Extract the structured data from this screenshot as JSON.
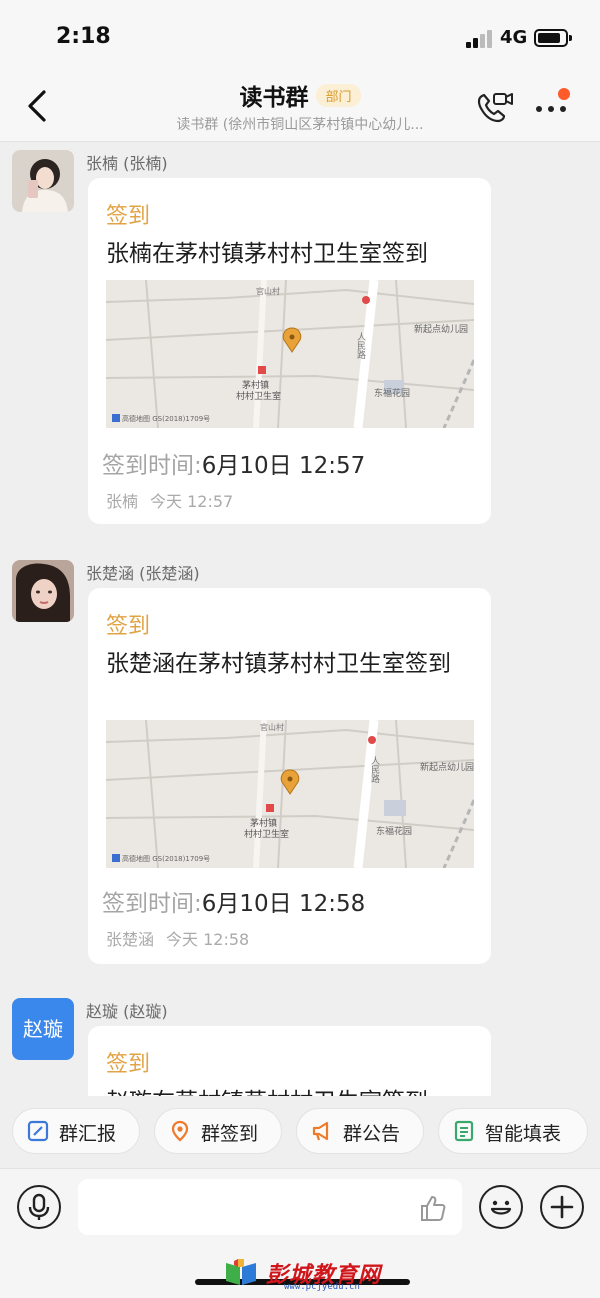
{
  "status_bar": {
    "time": "2:18",
    "network": "4G"
  },
  "header": {
    "title": "读书群",
    "badge": "部门",
    "subtitle": "读书群 (徐州市铜山区茅村镇中心幼儿..."
  },
  "messages": [
    {
      "sender": "张楠 (张楠)",
      "tag": "签到",
      "text": "张楠在茅村镇茅村村卫生室签到",
      "map": {
        "road": "官山村",
        "road2": "人民路",
        "poi1": "新起点幼儿园",
        "poi2": "茅村镇",
        "poi3": "村村卫生室",
        "poi4": "东福花园",
        "credit": "高德地图 GS(2018)1709号"
      },
      "time_label": "签到时间:",
      "time_value": "6月10日 12:57",
      "meta_name": "张楠",
      "meta_time": "今天 12:57"
    },
    {
      "sender": "张楚涵 (张楚涵)",
      "tag": "签到",
      "text": "张楚涵在茅村镇茅村村卫生室签到",
      "map": {
        "road": "官山村",
        "road2": "人民路",
        "poi1": "新起点幼儿园",
        "poi2": "茅村镇",
        "poi3": "村村卫生室",
        "poi4": "东福花园",
        "credit": "高德地图 GS(2018)1709号"
      },
      "time_label": "签到时间:",
      "time_value": "6月10日 12:58",
      "meta_name": "张楚涵",
      "meta_time": "今天 12:58"
    },
    {
      "sender": "赵璇 (赵璇)",
      "avatar_text": "赵璇",
      "tag": "签到",
      "text": "赵璇在茅村镇茅村村卫生室签到"
    }
  ],
  "quick_actions": [
    {
      "label": "群汇报",
      "icon": "report-icon"
    },
    {
      "label": "群签到",
      "icon": "location-pin-icon"
    },
    {
      "label": "群公告",
      "icon": "megaphone-icon"
    },
    {
      "label": "智能填表",
      "icon": "form-icon"
    }
  ],
  "input": {
    "placeholder": ""
  },
  "watermark": {
    "text": "彭城教育网",
    "url": "www.pcjyedu.cn"
  },
  "colors": {
    "accent": "#e2a345",
    "badge": "#d99a2a",
    "notify_dot": "#ff5a2a",
    "avatar_blue": "#3b88ec"
  }
}
